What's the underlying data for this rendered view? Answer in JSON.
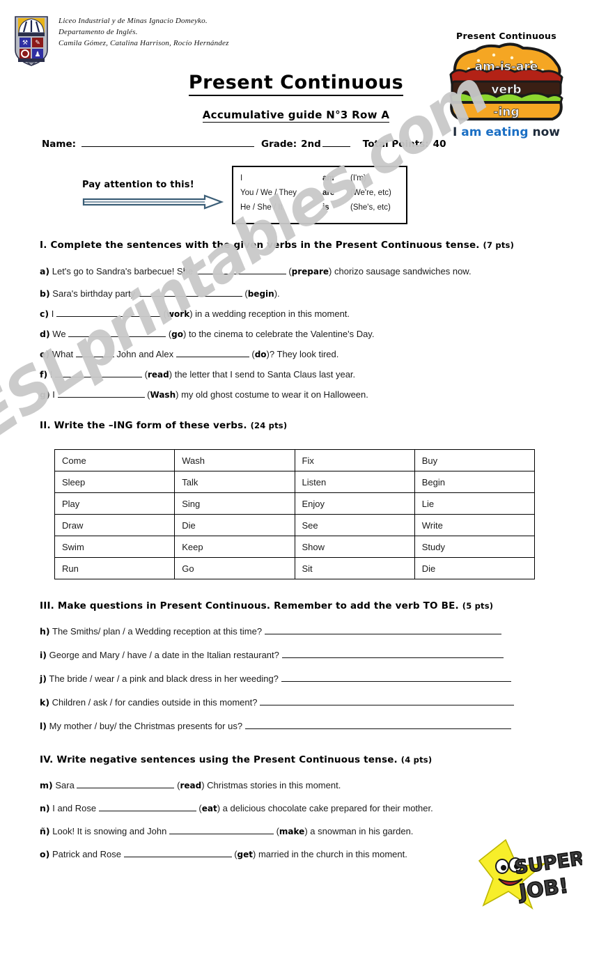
{
  "header": {
    "crest_icon": "school-crest-icon",
    "school_name": "Liceo Industrial y de Minas Ignacio Domeyko.",
    "department": "Departamento de Inglés.",
    "teachers": "Camila Gómez, Catalina Harrison, Rocío Hernández"
  },
  "clipart": {
    "burger": {
      "caption_top": "Present Continuous",
      "bun_top_text": "am-is-are",
      "patty_text": "verb",
      "bun_bottom_text": "-ing",
      "caption_bottom_1": "I",
      "caption_bottom_2": "am eating",
      "caption_bottom_3": "now",
      "color_bun": "#f5a623",
      "color_patty": "#3a1f14",
      "color_lettuce": "#8dd62f",
      "color_tomato": "#b32216",
      "color_blue_text": "#1b6fc4"
    },
    "superjob": {
      "line1": "SUPER",
      "line2": "JOB!",
      "star_color": "#f7ee2a"
    }
  },
  "titles": {
    "main": "Present Continuous",
    "sub": "Accumulative guide N°3   Row A"
  },
  "info": {
    "name_label": "Name:",
    "name_value": "",
    "grade_label": "Grade:",
    "grade_value": "2nd",
    "points_label": "Total Points:",
    "points_value": "40"
  },
  "attention": {
    "text": "Pay attention to this!",
    "arrow_color": "#3b5e77"
  },
  "grammar_box": {
    "rows": [
      {
        "subject": "I",
        "be": "am",
        "short": "(I'm)"
      },
      {
        "subject": "You / We / They",
        "be": "are",
        "short": "(We're, etc)"
      },
      {
        "subject": "He / She / It",
        "be": "is",
        "short": "(She's, etc)"
      }
    ]
  },
  "sections": [
    {
      "heading": "I. Complete the sentences with the given verbs in the Present Continuous tense.",
      "points": "(7 pts)"
    },
    {
      "heading": "II. Write the –ING form of these verbs.",
      "points": "(24 pts)"
    },
    {
      "heading": "III. Make questions in Present Continuous. Remember to add the verb TO BE.",
      "points": "(5 pts)"
    },
    {
      "heading": "IV. Write negative sentences using the Present Continuous tense.",
      "points": "(4 pts)"
    }
  ],
  "section1_items": [
    {
      "letter": "a)",
      "pre": "Let's go to Sandra's barbecue! She",
      "verb": "prepare",
      "post": "chorizo sausage sandwiches now.",
      "blank_w": 130
    },
    {
      "letter": "b)",
      "pre": "Sara's birthday party",
      "verb": "begin",
      "post": ".",
      "blank_w": 150
    },
    {
      "letter": "c)",
      "pre": "I",
      "verb": "work",
      "post": "in a wedding reception in this moment.",
      "blank_w": 150
    },
    {
      "letter": "d)",
      "pre": "We",
      "verb": "go",
      "post": "to the cinema to celebrate the Valentine's Day.",
      "blank_w": 140
    },
    {
      "letter": "e)",
      "pre": "What",
      "verb": "do",
      "post": "? They look tired.",
      "mid": "John and Alex",
      "blank_w": 105,
      "blank2_w": 55
    },
    {
      "letter": "f)",
      "pre": "I",
      "verb": "read",
      "post": "the letter that I send to Santa Claus last year.",
      "blank_w": 125
    },
    {
      "letter": "g)",
      "pre": "I",
      "verb": "Wash",
      "post": "my old ghost costume to wear it on Halloween.",
      "blank_w": 125
    }
  ],
  "verb_table": {
    "rows": [
      [
        "Come",
        "Wash",
        "Fix",
        "Buy"
      ],
      [
        "Sleep",
        "Talk",
        "Listen",
        "Begin"
      ],
      [
        "Play",
        "Sing",
        "Enjoy",
        "Lie"
      ],
      [
        "Draw",
        "Die",
        "See",
        "Write"
      ],
      [
        "Swim",
        "Keep",
        "Show",
        "Study"
      ],
      [
        "Run",
        "Go",
        "Sit",
        "Die"
      ]
    ]
  },
  "section3_items": [
    {
      "letter": "h)",
      "text": "The Smiths/ plan / a Wedding reception at this time?",
      "blank_w": 340
    },
    {
      "letter": "i)",
      "text": "George and Mary / have / a date in the Italian restaurant?",
      "blank_w": 318
    },
    {
      "letter": "j)",
      "text": "The bride / wear / a pink and black dress in her weeding?",
      "blank_w": 330
    },
    {
      "letter": "k)",
      "text": "Children / ask / for candies outside in this moment?",
      "blank_w": 365
    },
    {
      "letter": "l)",
      "text": "My mother / buy/ the Christmas presents for us?",
      "blank_w": 382
    }
  ],
  "section4_items": [
    {
      "letter": "m)",
      "pre": "Sara",
      "verb": "read",
      "post": "Christmas stories in this moment.",
      "blank_w": 140
    },
    {
      "letter": "n)",
      "pre": "I and Rose",
      "verb": "eat",
      "post": "a delicious chocolate cake prepared for their mother.",
      "blank_w": 140
    },
    {
      "letter": "ñ)",
      "pre": "Look! It is snowing and John",
      "verb": "make",
      "post": "a snowman in his garden.",
      "blank_w": 150
    },
    {
      "letter": "o)",
      "pre": "Patrick and Rose",
      "verb": "get",
      "post": "married in the church in this moment.",
      "blank_w": 155
    }
  ],
  "watermark": {
    "text": "ESLprintables.com",
    "color": "#c9c9c9"
  }
}
